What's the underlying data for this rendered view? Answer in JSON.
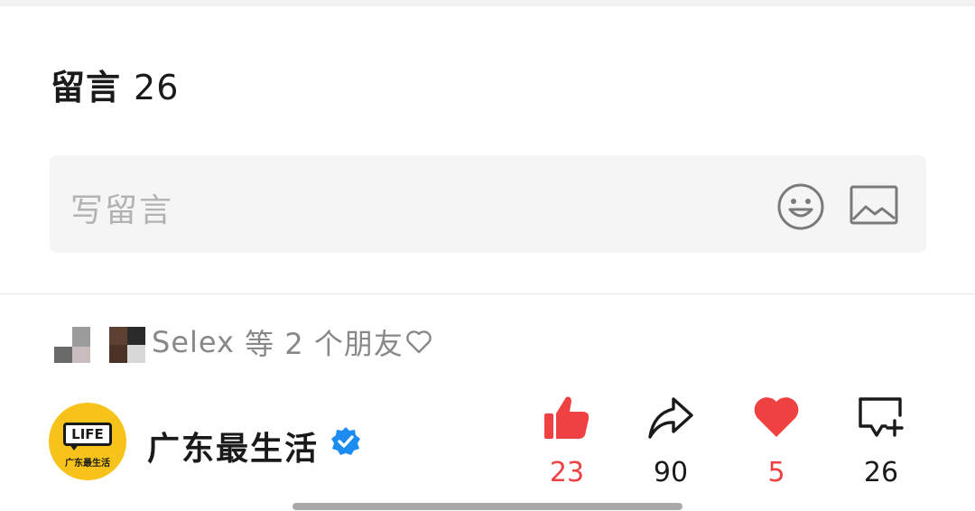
{
  "comments": {
    "title": "留言",
    "count": "26",
    "input_placeholder": "写留言",
    "emoji_icon": "smiley-face-icon",
    "image_icon": "image-picture-icon"
  },
  "friends": {
    "name": "Selex",
    "suffix": "等",
    "count_text": "2 个朋友",
    "heart_icon": "heart-outline-icon"
  },
  "account": {
    "logo_text": "LIFE",
    "logo_subtext": "广东最生活",
    "name": "广东最生活",
    "verified_icon": "verified-badge-icon",
    "brand_color": "#f7c31b"
  },
  "actions": [
    {
      "icon": "thumbs-up-icon",
      "count": "23",
      "active": true
    },
    {
      "icon": "share-arrow-icon",
      "count": "90",
      "active": false
    },
    {
      "icon": "heart-icon",
      "count": "5",
      "active": true
    },
    {
      "icon": "comment-add-icon",
      "count": "26",
      "active": false
    }
  ],
  "colors": {
    "accent_red": "#f04142",
    "verified_blue": "#1d8cf0",
    "muted_text": "#888888"
  }
}
